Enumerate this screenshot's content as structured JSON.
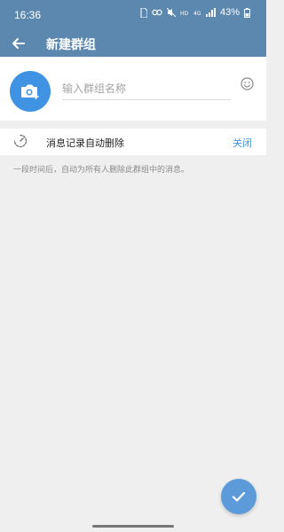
{
  "status_bar": {
    "time": "16:36",
    "indicators": [
      "sim-icon",
      "link-icon",
      "mute-icon",
      "hd-icon",
      "4g-icon",
      "signal-icon"
    ],
    "battery_percent": "43%"
  },
  "app_bar": {
    "title": "新建群组"
  },
  "group": {
    "name_placeholder": "输入群组名称",
    "name_value": ""
  },
  "auto_delete": {
    "label": "消息记录自动删除",
    "value": "关闭",
    "description": "一段时间后，自动为所有人删除此群组中的消息。"
  },
  "colors": {
    "primary": "#5c88b0",
    "accent": "#3f93e2",
    "fab": "#5c9ad9",
    "background": "#efefef"
  }
}
